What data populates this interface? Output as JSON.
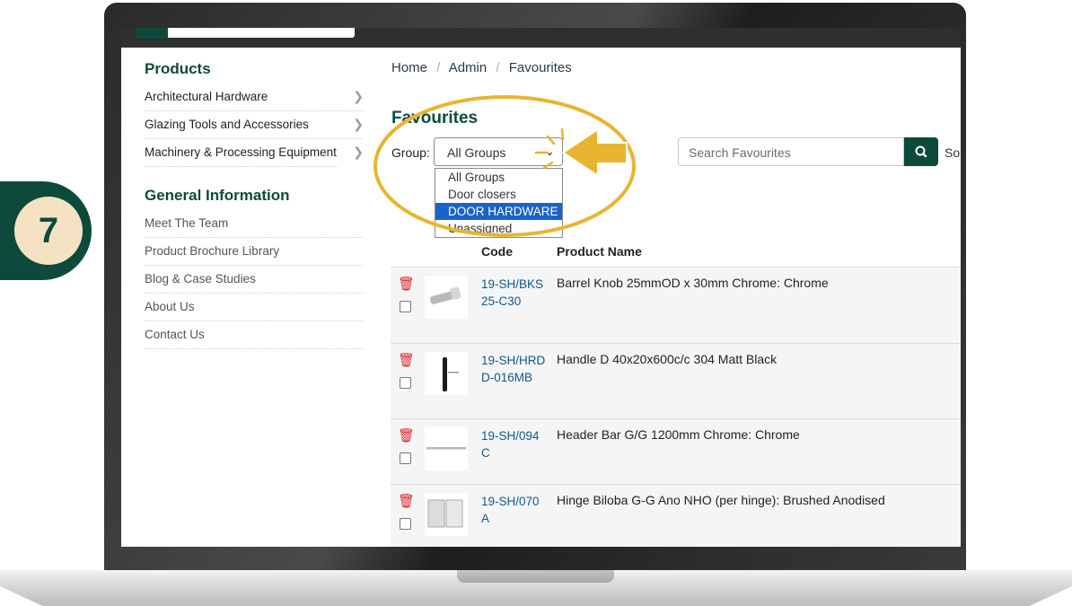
{
  "topbar": {},
  "sidebar": {
    "products_heading": "Products",
    "product_items": [
      {
        "label": "Architectural Hardware"
      },
      {
        "label": "Glazing Tools and Accessories"
      },
      {
        "label": "Machinery & Processing Equipment"
      }
    ],
    "general_heading": "General Information",
    "general_items": [
      {
        "label": "Meet The Team"
      },
      {
        "label": "Product Brochure Library"
      },
      {
        "label": "Blog & Case Studies"
      },
      {
        "label": "About Us"
      },
      {
        "label": "Contact Us"
      }
    ]
  },
  "breadcrumb": {
    "home": "Home",
    "admin": "Admin",
    "current": "Favourites",
    "separator": "/"
  },
  "page_title": "Favourites",
  "group": {
    "label": "Group:",
    "selected": "All Groups",
    "options": [
      "All Groups",
      "Door closers",
      "DOOR HARDWARE",
      "Unassigned"
    ],
    "highlighted_option": "DOOR HARDWARE"
  },
  "search": {
    "placeholder": "Search Favourites",
    "sort_label": "So"
  },
  "table": {
    "headers": {
      "code": "Code",
      "product_name": "Product Name"
    },
    "rows": [
      {
        "code": "19-SH/BKS25-C30",
        "name": "Barrel Knob 25mmOD x 30mm Chrome: Chrome"
      },
      {
        "code": "19-SH/HRDD-016MB",
        "name": "Handle D 40x20x600c/c 304 Matt Black"
      },
      {
        "code": "19-SH/094C",
        "name": "Header Bar G/G 1200mm Chrome: Chrome"
      },
      {
        "code": "19-SH/070A",
        "name": "Hinge Biloba G-G Ano NHO (per hinge): Brushed Anodised"
      }
    ]
  },
  "step_badge": {
    "number": "7"
  },
  "colors": {
    "brand": "#0d4a3c",
    "highlight": "#e8b531",
    "delete": "#d9262c",
    "option_selected": "#1a63c6"
  }
}
